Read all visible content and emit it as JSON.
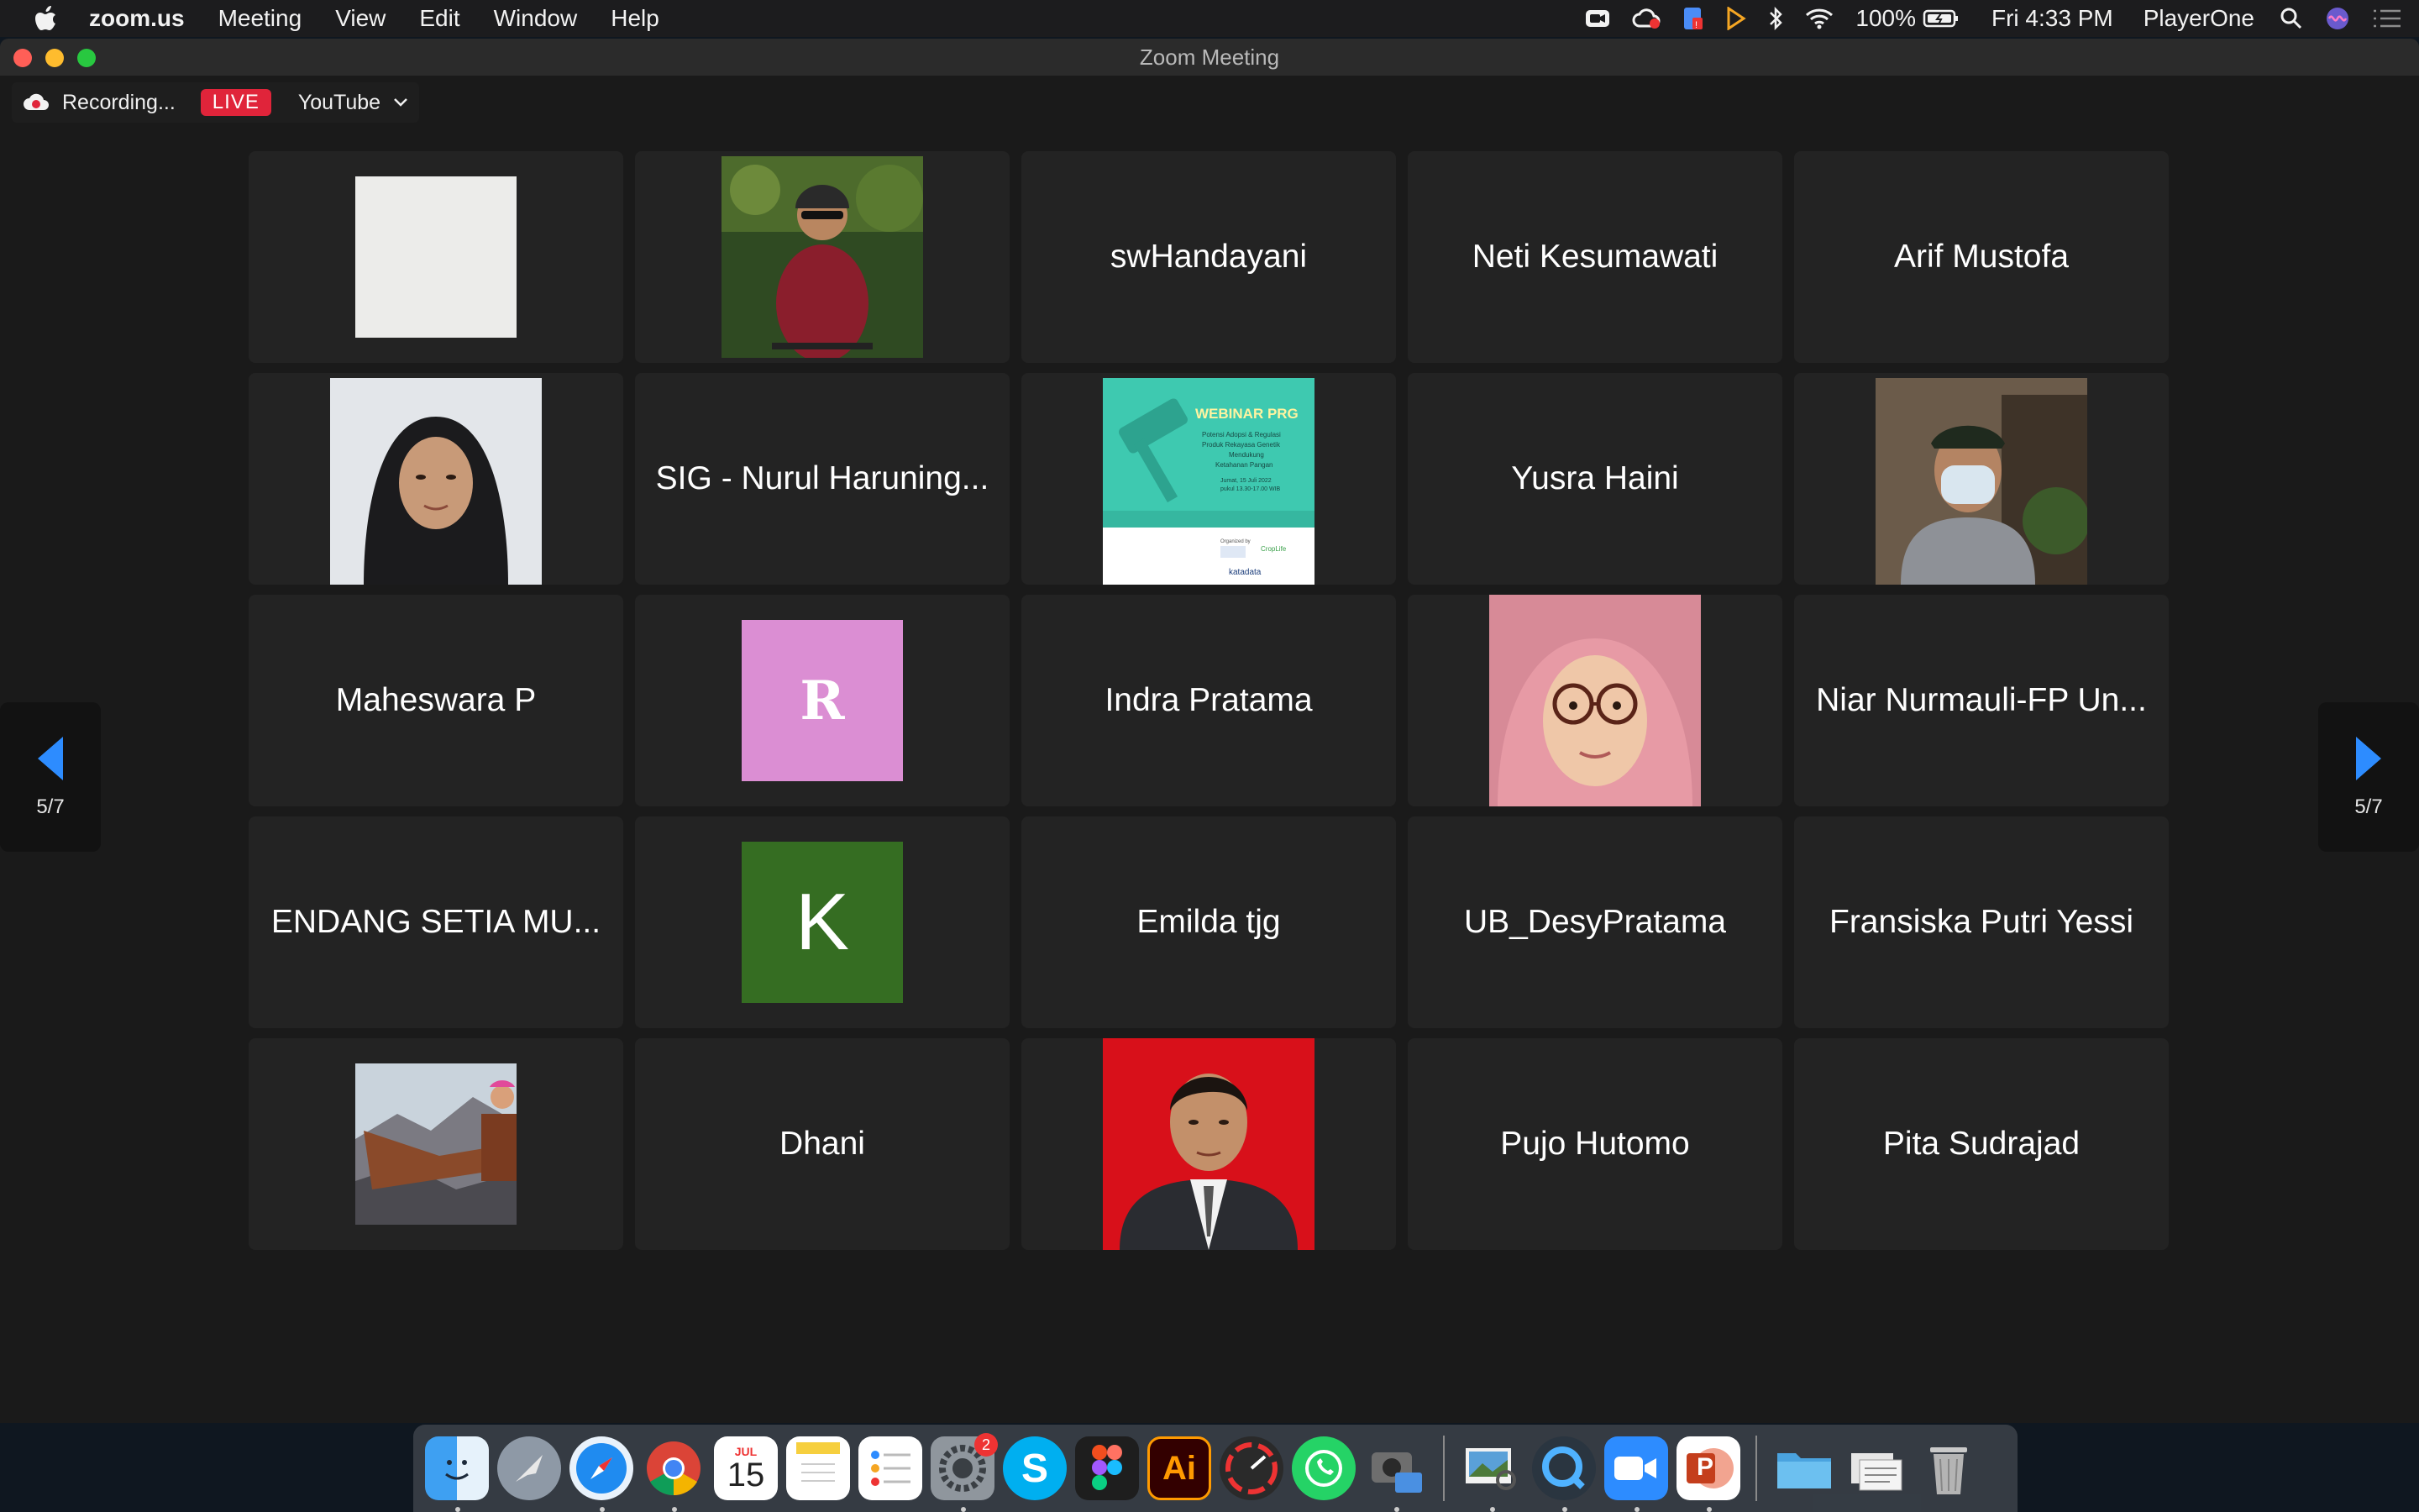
{
  "menubar": {
    "app_name": "zoom.us",
    "menus": [
      "Meeting",
      "View",
      "Edit",
      "Window",
      "Help"
    ],
    "battery": "100%",
    "clock": "Fri 4:33 PM",
    "user": "PlayerOne"
  },
  "window": {
    "title": "Zoom Meeting"
  },
  "recording": {
    "label": "Recording...",
    "live_badge": "LIVE",
    "stream_target": "YouTube"
  },
  "pager": {
    "left": "5/7",
    "right": "5/7"
  },
  "participants": [
    {
      "name": "",
      "type": "photo",
      "icon": "blank-canvas-photo"
    },
    {
      "name": "",
      "type": "photo",
      "icon": "cyclist-photo"
    },
    {
      "name": "swHandayani",
      "type": "name"
    },
    {
      "name": "Neti Kesumawati",
      "type": "name"
    },
    {
      "name": "Arif Mustofa",
      "type": "name"
    },
    {
      "name": "",
      "type": "photo",
      "icon": "hijab-woman-photo"
    },
    {
      "name": "SIG - Nurul Haruning...",
      "type": "name"
    },
    {
      "name": "",
      "type": "photo",
      "icon": "webinar-poster-photo",
      "poster": {
        "title": "WEBINAR PRG",
        "subtitle": "Potensi Adopsi & Regulasi Produk Rekayasa Genetik Mendukung Ketahanan Pangan",
        "date": "Jumat, 15 Juli 2022",
        "time": "pukul 13.30-17.00 WIB",
        "organizer": "Organized by",
        "sponsor": "CropLife",
        "media": "katadata"
      }
    },
    {
      "name": "Yusra Haini",
      "type": "name"
    },
    {
      "name": "",
      "type": "photo",
      "icon": "masked-man-photo"
    },
    {
      "name": "Maheswara P",
      "type": "name"
    },
    {
      "name": "",
      "type": "avatar",
      "letter": "R",
      "color": "#db8ed3"
    },
    {
      "name": "Indra Pratama",
      "type": "name"
    },
    {
      "name": "",
      "type": "photo",
      "icon": "glasses-woman-photo"
    },
    {
      "name": "Niar Nurmauli-FP Un...",
      "type": "name"
    },
    {
      "name": "ENDANG SETIA MU...",
      "type": "name"
    },
    {
      "name": "",
      "type": "avatar",
      "letter": "K",
      "color": "#356d22"
    },
    {
      "name": "Emilda tjg",
      "type": "name"
    },
    {
      "name": "UB_DesyPratama",
      "type": "name"
    },
    {
      "name": "Fransiska Putri Yessi",
      "type": "name"
    },
    {
      "name": "",
      "type": "photo",
      "icon": "mountain-selfie-photo"
    },
    {
      "name": "Dhani",
      "type": "name"
    },
    {
      "name": "",
      "type": "photo",
      "icon": "formal-portrait-photo"
    },
    {
      "name": "Pujo Hutomo",
      "type": "name"
    },
    {
      "name": "Pita Sudrajad",
      "type": "name"
    }
  ],
  "dock": {
    "calendar_month": "JUL",
    "calendar_day": "15",
    "preferences_badge": "2",
    "illustrator_label": "Ai",
    "skype_label": "S",
    "powerpoint_label": "P"
  },
  "colors": {
    "accent_blue": "#2d8cff",
    "live_red": "#e0243a",
    "tile_bg": "#232323"
  }
}
